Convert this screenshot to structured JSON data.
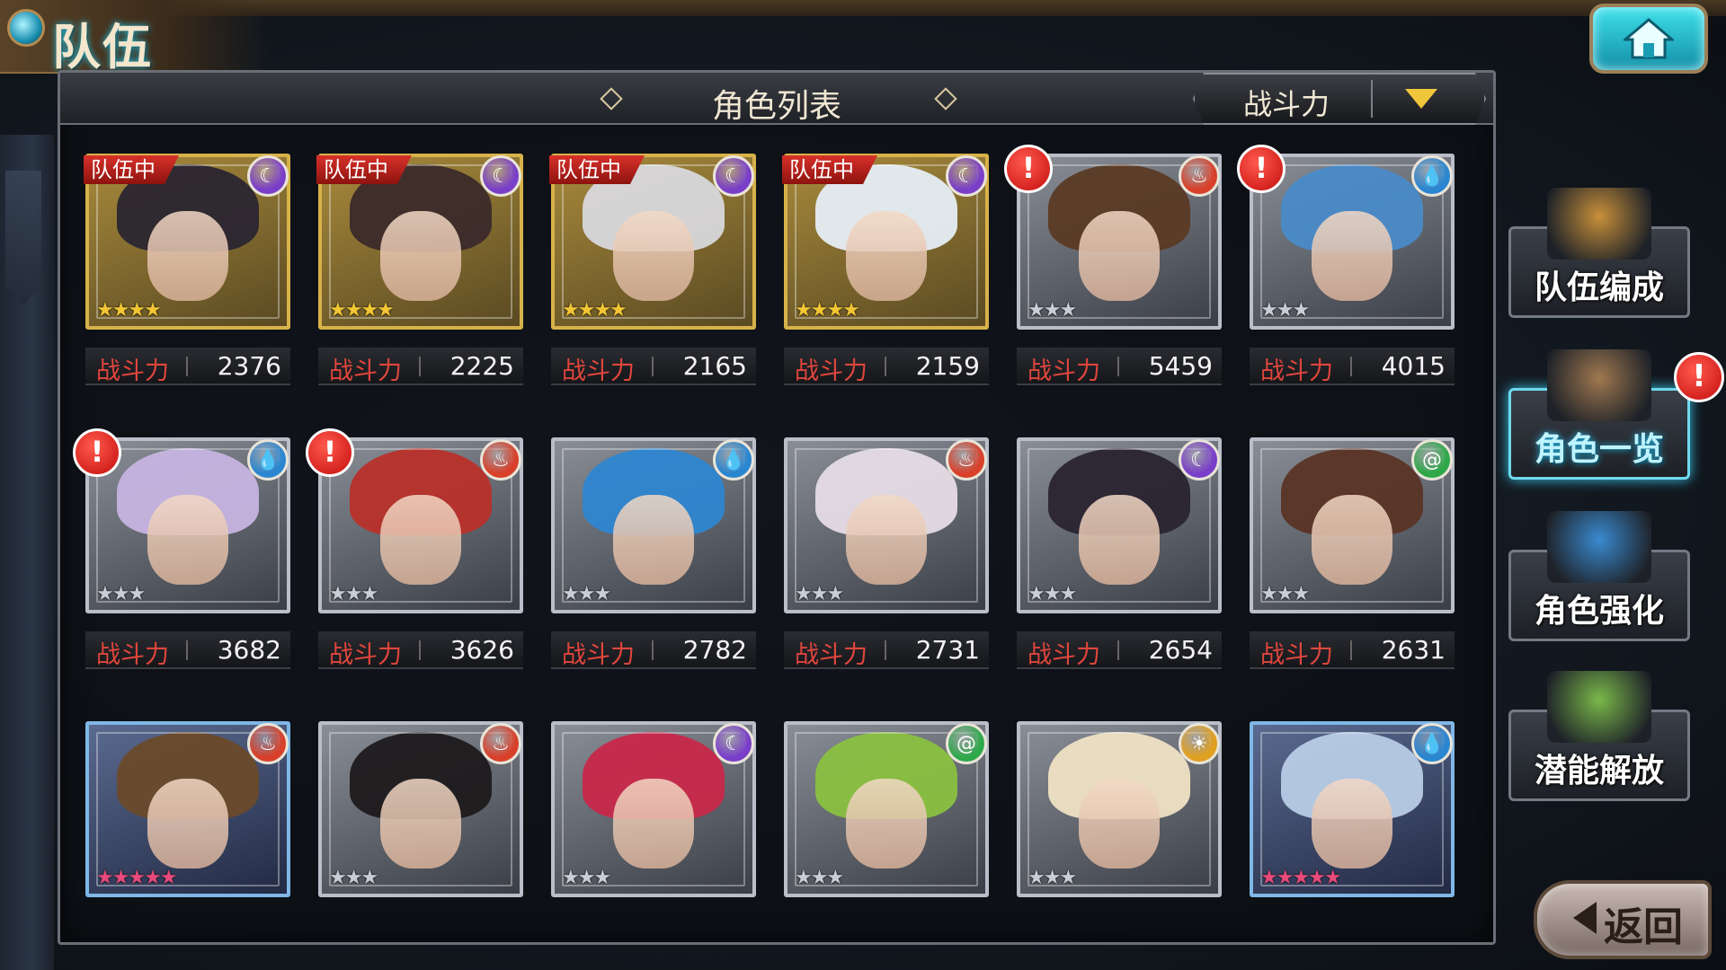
{
  "header": {
    "title": "队伍"
  },
  "panel": {
    "title": "角色列表",
    "sort_label": "战斗力"
  },
  "power_label": "战斗力",
  "element_colors": {
    "moon": "#7a3fc8",
    "fire": "#d8402a",
    "water": "#2a86d0",
    "wind": "#2fa84a",
    "light": "#e0a020"
  },
  "cards": [
    {
      "in_team": true,
      "team_label": "队伍中",
      "element": "moon",
      "stars": 4,
      "power": "2376",
      "alert": false,
      "frame": "gold",
      "hair": "#2a2530"
    },
    {
      "in_team": true,
      "team_label": "队伍中",
      "element": "moon",
      "stars": 4,
      "power": "2225",
      "alert": false,
      "frame": "gold",
      "hair": "#3b2a2a"
    },
    {
      "in_team": true,
      "team_label": "队伍中",
      "element": "moon",
      "stars": 4,
      "power": "2165",
      "alert": false,
      "frame": "gold",
      "hair": "#d8d8dc"
    },
    {
      "in_team": true,
      "team_label": "队伍中",
      "element": "moon",
      "stars": 4,
      "power": "2159",
      "alert": false,
      "frame": "gold",
      "hair": "#e6eef6"
    },
    {
      "in_team": false,
      "element": "fire",
      "stars": 3,
      "power": "5459",
      "alert": true,
      "frame": "silver",
      "hair": "#5a3a24"
    },
    {
      "in_team": false,
      "element": "water",
      "stars": 3,
      "power": "4015",
      "alert": true,
      "frame": "silver",
      "hair": "#4a8ac8"
    },
    {
      "in_team": false,
      "element": "water",
      "stars": 3,
      "power": "3682",
      "alert": true,
      "frame": "silver",
      "hair": "#c6b4e0"
    },
    {
      "in_team": false,
      "element": "fire",
      "stars": 3,
      "power": "3626",
      "alert": true,
      "frame": "silver",
      "hair": "#b8302a"
    },
    {
      "in_team": false,
      "element": "water",
      "stars": 3,
      "power": "2782",
      "alert": false,
      "frame": "silver",
      "hair": "#2e86d0"
    },
    {
      "in_team": false,
      "element": "fire",
      "stars": 3,
      "power": "2731",
      "alert": false,
      "frame": "silver",
      "hair": "#e6dce6"
    },
    {
      "in_team": false,
      "element": "moon",
      "stars": 3,
      "power": "2654",
      "alert": false,
      "frame": "silver",
      "hair": "#2a2430"
    },
    {
      "in_team": false,
      "element": "wind",
      "stars": 3,
      "power": "2631",
      "alert": false,
      "frame": "silver",
      "hair": "#5a3426"
    },
    {
      "in_team": false,
      "element": "fire",
      "stars": 5,
      "power": "",
      "alert": false,
      "frame": "blue",
      "hair": "#6a4a2a"
    },
    {
      "in_team": false,
      "element": "fire",
      "stars": 3,
      "power": "",
      "alert": false,
      "frame": "silver",
      "hair": "#1e1a1c"
    },
    {
      "in_team": false,
      "element": "moon",
      "stars": 3,
      "power": "",
      "alert": false,
      "frame": "silver",
      "hair": "#c8284a"
    },
    {
      "in_team": false,
      "element": "wind",
      "stars": 3,
      "power": "",
      "alert": false,
      "frame": "silver",
      "hair": "#8ac040"
    },
    {
      "in_team": false,
      "element": "light",
      "stars": 3,
      "power": "",
      "alert": false,
      "frame": "silver",
      "hair": "#efe2c4"
    },
    {
      "in_team": false,
      "element": "water",
      "stars": 5,
      "power": "",
      "alert": false,
      "frame": "blue",
      "hair": "#b8cce6"
    }
  ],
  "side_menu": [
    {
      "label": "队伍编成",
      "active": false,
      "alert": false,
      "art_color": "#c8903a"
    },
    {
      "label": "角色一览",
      "active": true,
      "alert": true,
      "art_color": "#a07850"
    },
    {
      "label": "角色强化",
      "active": false,
      "alert": false,
      "art_color": "#3a8ad0"
    },
    {
      "label": "潜能解放",
      "active": false,
      "alert": false,
      "art_color": "#7ab84a"
    }
  ],
  "alert_glyph": "!",
  "back": {
    "label": "返回"
  }
}
